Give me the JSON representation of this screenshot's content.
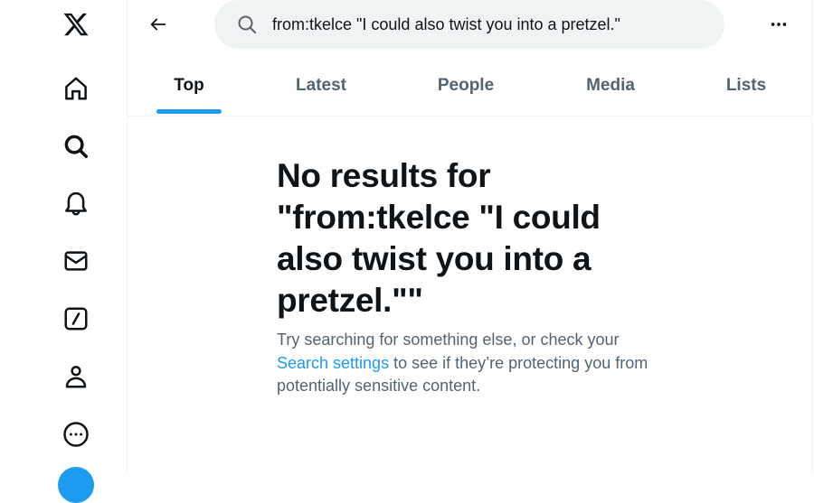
{
  "sidebar": {
    "items": [
      {
        "name": "x-logo",
        "label": "X"
      },
      {
        "name": "home",
        "label": "Home"
      },
      {
        "name": "explore",
        "label": "Explore"
      },
      {
        "name": "notifications",
        "label": "Notifications"
      },
      {
        "name": "messages",
        "label": "Messages"
      },
      {
        "name": "grok",
        "label": "Grok"
      },
      {
        "name": "profile",
        "label": "Profile"
      },
      {
        "name": "more",
        "label": "More"
      }
    ]
  },
  "header": {
    "search_value": "from:tkelce \"I could also twist you into a pretzel.\""
  },
  "tabs": [
    {
      "label": "Top",
      "active": true
    },
    {
      "label": "Latest",
      "active": false
    },
    {
      "label": "People",
      "active": false
    },
    {
      "label": "Media",
      "active": false
    },
    {
      "label": "Lists",
      "active": false
    }
  ],
  "empty_state": {
    "title": "No results for \"from:tkelce \"I could also twist you into a pretzel.\"\"",
    "body_before": "Try searching for something else, or check your ",
    "link": "Search settings",
    "body_after": " to see if they’re protecting you from potentially sensitive content."
  },
  "colors": {
    "accent": "#1d9bf0",
    "text_primary": "#0f1419",
    "text_secondary": "#536471",
    "search_bg": "#eff3f4"
  }
}
